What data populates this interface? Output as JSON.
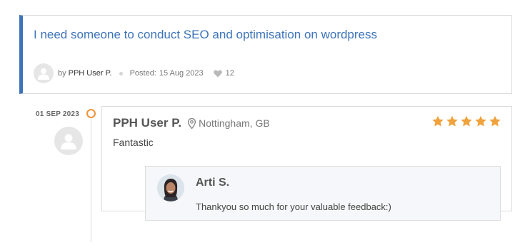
{
  "project": {
    "title": "I need someone to conduct SEO and optimisation on wordpress",
    "by_label": "by",
    "user": "PPH User P.",
    "posted_label": "Posted:",
    "posted_date": "15 Aug 2023",
    "likes": "12"
  },
  "timeline": {
    "date": "01 SEP 2023"
  },
  "review": {
    "reviewer_name": "PPH User P.",
    "location": "Nottingham, GB",
    "rating": 5,
    "rating_max": 5,
    "text": "Fantastic"
  },
  "reply": {
    "name": "Arti S.",
    "text": "Thankyou so much for your valuable feedback:)"
  },
  "colors": {
    "accent_blue": "#3d73b9",
    "star_orange": "#f0a23c",
    "timeline_dot": "#f0933a"
  },
  "icons": {
    "placeholder_avatar": "user-silhouette-icon",
    "location": "map-pin-icon",
    "likes": "heart-icon",
    "rating": "star-icon"
  }
}
